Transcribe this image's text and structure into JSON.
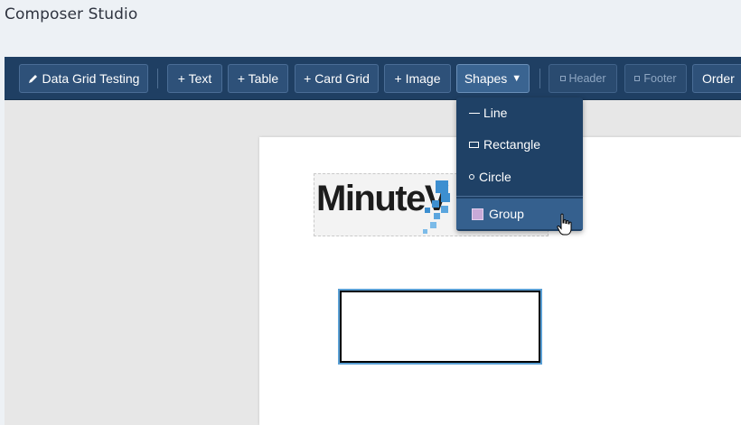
{
  "app": {
    "title": "Composer Studio"
  },
  "toolbar": {
    "data_grid_label": "Data Grid Testing",
    "text_label": "+ Text",
    "table_label": "+ Table",
    "card_grid_label": "+ Card Grid",
    "image_label": "+ Image",
    "shapes_label": "Shapes",
    "header_label": "Header",
    "footer_label": "Footer",
    "order_label": "Order"
  },
  "shapes_menu": {
    "items": [
      {
        "label": "Line",
        "icon": "line-icon"
      },
      {
        "label": "Rectangle",
        "icon": "rectangle-icon"
      },
      {
        "label": "Circle",
        "icon": "circle-icon"
      },
      {
        "label": "Group",
        "icon": "group-icon"
      }
    ]
  },
  "canvas": {
    "logo_text": "MinuteV"
  },
  "colors": {
    "toolbar_bg": "#1f3f63",
    "button_bg": "#2e5179",
    "menu_bg": "#1f4166",
    "menu_hover": "#35608e",
    "selection_outline": "#5a9fd4",
    "logo_accent": "#3d8fd0"
  }
}
